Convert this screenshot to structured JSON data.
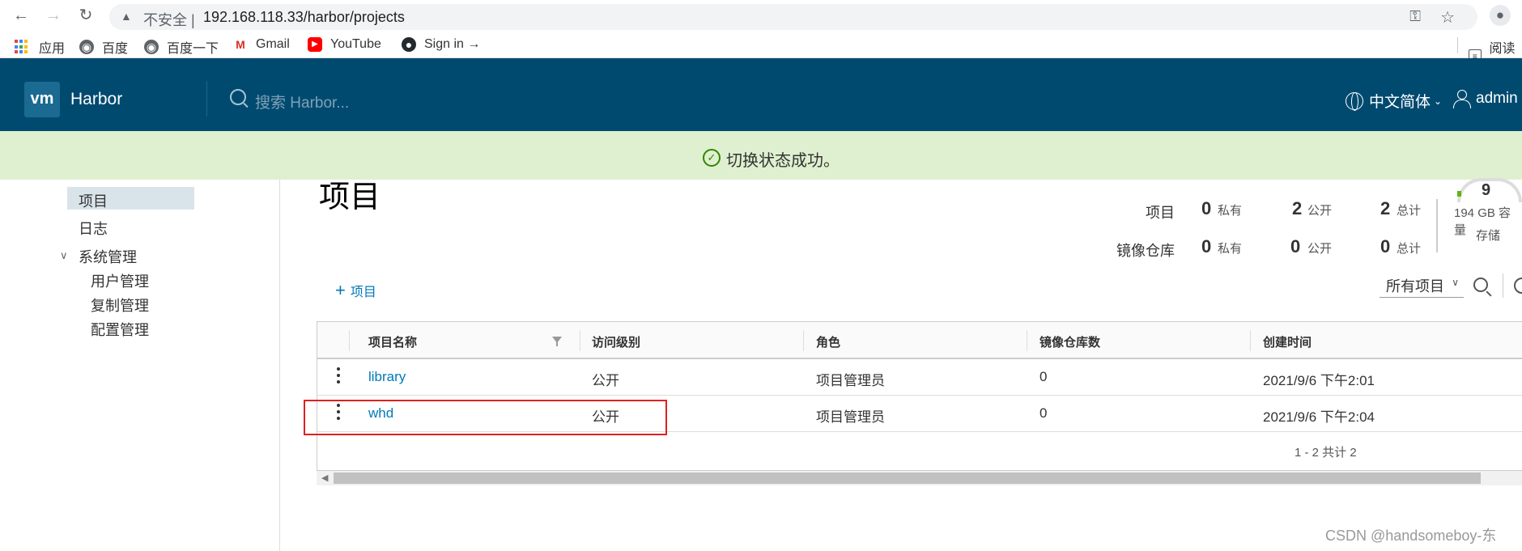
{
  "browser": {
    "insecure_label": "不安全 |",
    "url": "192.168.118.33/harbor/projects",
    "bookmarks": [
      "应用",
      "百度",
      "百度一下",
      "Gmail",
      "YouTube",
      "Sign in →"
    ],
    "reading_list": "阅读清"
  },
  "header": {
    "logo_text": "vm",
    "brand": "Harbor",
    "search_placeholder": "搜索 Harbor...",
    "language": "中文简体",
    "user": "admin"
  },
  "alert": {
    "message": "切换状态成功。",
    "color": "#dff0d0"
  },
  "sidebar": {
    "items": [
      "项目",
      "日志",
      "系统管理"
    ],
    "admin_items": [
      "用户管理",
      "复制管理",
      "配置管理"
    ]
  },
  "page": {
    "title": "项目",
    "stats": {
      "projects_label": "项目",
      "repos_label": "镜像仓库",
      "projects": {
        "private": "0",
        "public": "2",
        "total": "2"
      },
      "repos": {
        "private": "0",
        "public": "0",
        "total": "0"
      },
      "private_label": "私有",
      "public_label": "公开",
      "total_label": "总计"
    },
    "storage": {
      "value": "9",
      "capacity": "194 GB 容量",
      "label": "存储"
    },
    "add_project": "项目",
    "filter_select": "所有项目"
  },
  "table": {
    "columns": [
      "项目名称",
      "访问级别",
      "角色",
      "镜像仓库数",
      "创建时间"
    ],
    "rows": [
      {
        "name": "library",
        "access": "公开",
        "role": "项目管理员",
        "repo_count": "0",
        "created": "2021/9/6 下午2:01"
      },
      {
        "name": "whd",
        "access": "公开",
        "role": "项目管理员",
        "repo_count": "0",
        "created": "2021/9/6 下午2:04"
      }
    ],
    "footer": "1 - 2 共计 2"
  },
  "watermark": "CSDN @handsomeboy-东",
  "colors": {
    "header": "#004a70",
    "link": "#0079b8",
    "highlight": "#e02020"
  }
}
